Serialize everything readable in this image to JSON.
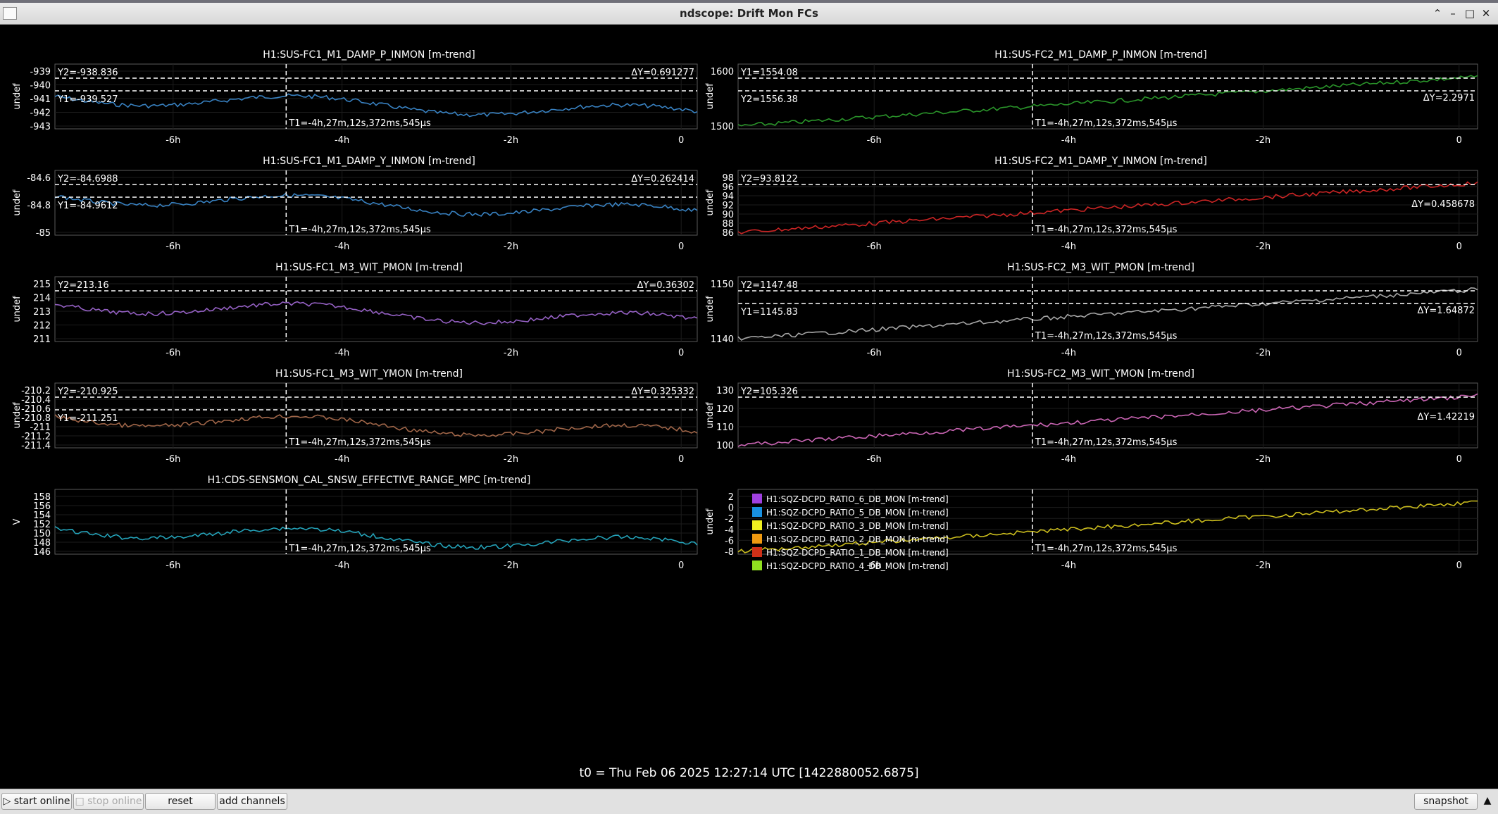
{
  "window": {
    "title": "ndscope: Drift Mon FCs",
    "buttons": {
      "keep_above": "⌃",
      "minimize": "–",
      "maximize": "□",
      "close": "✕"
    }
  },
  "plots": [
    {
      "title": "H1:SUS-FC1_M1_DAMP_P_INMON [m-trend]",
      "ylabel": "undef",
      "yticks": [
        "-939",
        "-940",
        "-941",
        "-942",
        "-943"
      ],
      "xticks": [
        "-6h",
        "-4h",
        "-2h",
        "0"
      ],
      "cursor_labels": [
        "Y2=-938.836",
        "Y1=-939.527"
      ],
      "delta": "ΔY=0.691277",
      "t1": "T1=-4h,27m,12s,372ms,545µs",
      "color": "#3e8fd6"
    },
    {
      "title": "H1:SUS-FC2_M1_DAMP_P_INMON [m-trend]",
      "ylabel": "undef",
      "yticks": [
        "1600",
        "1500"
      ],
      "xticks": [
        "-6h",
        "-4h",
        "-2h",
        "0"
      ],
      "cursor_labels": [
        "Y1=1554.08",
        "Y2=1556.38"
      ],
      "delta": "ΔY=2.2971",
      "t1": "T1=-4h,27m,12s,372ms,545µs",
      "color": "#2fa52f"
    },
    {
      "title": "H1:SUS-FC1_M1_DAMP_Y_INMON [m-trend]",
      "ylabel": "undef",
      "yticks": [
        "-84.6",
        "-84.8",
        "-85"
      ],
      "xticks": [
        "-6h",
        "-4h",
        "-2h",
        "0"
      ],
      "cursor_labels": [
        "Y2=-84.6988",
        "Y1=-84.9612"
      ],
      "delta": "ΔY=0.262414",
      "t1": "T1=-4h,27m,12s,372ms,545µs",
      "color": "#3e8fd6"
    },
    {
      "title": "H1:SUS-FC2_M1_DAMP_Y_INMON [m-trend]",
      "ylabel": "undef",
      "yticks": [
        "98",
        "96",
        "94",
        "92",
        "90",
        "88",
        "86"
      ],
      "xticks": [
        "-6h",
        "-4h",
        "-2h",
        "0"
      ],
      "cursor_labels": [
        "Y2=93.8122"
      ],
      "delta": "ΔY=0.458678",
      "t1": "T1=-4h,27m,12s,372ms,545µs",
      "color": "#e02828"
    },
    {
      "title": "H1:SUS-FC1_M3_WIT_PMON [m-trend]",
      "ylabel": "undef",
      "yticks": [
        "215",
        "214",
        "213",
        "212",
        "211"
      ],
      "xticks": [
        "-6h",
        "-4h",
        "-2h",
        "0"
      ],
      "cursor_labels": [
        "Y2=213.16"
      ],
      "delta": "ΔY=0.36302",
      "t1": "",
      "color": "#a46ad8"
    },
    {
      "title": "H1:SUS-FC2_M3_WIT_PMON [m-trend]",
      "ylabel": "undef",
      "yticks": [
        "1150",
        "1140"
      ],
      "xticks": [
        "-6h",
        "-4h",
        "-2h",
        "0"
      ],
      "cursor_labels": [
        "Y2=1147.48",
        "Y1=1145.83"
      ],
      "delta": "ΔY=1.64872",
      "t1": "T1=-4h,27m,12s,372ms,545µs",
      "color": "#b8b8b8"
    },
    {
      "title": "H1:SUS-FC1_M3_WIT_YMON [m-trend]",
      "ylabel": "undef",
      "yticks": [
        "-210.2",
        "-210.4",
        "-210.6",
        "-210.8",
        "-211",
        "-211.2",
        "-211.4"
      ],
      "xticks": [
        "-6h",
        "-4h",
        "-2h",
        "0"
      ],
      "cursor_labels": [
        "Y2=-210.925",
        "Y1=-211.251"
      ],
      "delta": "ΔY=0.325332",
      "t1": "T1=-4h,27m,12s,372ms,545µs",
      "color": "#b07050"
    },
    {
      "title": "H1:SUS-FC2_M3_WIT_YMON [m-trend]",
      "ylabel": "undef",
      "yticks": [
        "130",
        "120",
        "110",
        "100"
      ],
      "xticks": [
        "-6h",
        "-4h",
        "-2h",
        "0"
      ],
      "cursor_labels": [
        "Y2=105.326"
      ],
      "delta": "ΔY=1.42219",
      "t1": "T1=-4h,27m,12s,372ms,545µs",
      "color": "#e070c8"
    },
    {
      "title": "H1:CDS-SENSMON_CAL_SNSW_EFFECTIVE_RANGE_MPC [m-trend]",
      "ylabel": "V",
      "yticks": [
        "158",
        "156",
        "154",
        "152",
        "150",
        "148",
        "146"
      ],
      "xticks": [
        "-6h",
        "-4h",
        "-2h",
        "0"
      ],
      "cursor_labels": [],
      "delta": "",
      "t1": "T1=-4h,27m,12s,372ms,545µs",
      "color": "#28b4cc"
    },
    {
      "title": "",
      "ylabel": "undef",
      "yticks": [
        "2",
        "0",
        "-2",
        "-4",
        "-6",
        "-8"
      ],
      "xticks": [
        "-6h",
        "-4h",
        "-2h",
        "0"
      ],
      "cursor_labels": [],
      "delta": "",
      "t1": "T1=-4h,27m,12s,372ms,545µs",
      "color": "#e0d020",
      "legend": [
        {
          "name": "H1:SQZ-DCPD_RATIO_6_DB_MON [m-trend]",
          "color": "#a040e0"
        },
        {
          "name": "H1:SQZ-DCPD_RATIO_5_DB_MON [m-trend]",
          "color": "#1890e0"
        },
        {
          "name": "H1:SQZ-DCPD_RATIO_3_DB_MON [m-trend]",
          "color": "#f0f020"
        },
        {
          "name": "H1:SQZ-DCPD_RATIO_2_DB_MON [m-trend]",
          "color": "#f09a10"
        },
        {
          "name": "H1:SQZ-DCPD_RATIO_1_DB_MON [m-trend]",
          "color": "#d03018"
        },
        {
          "name": "H1:SQZ-DCPD_RATIO_4_DB_MON [m-trend]",
          "color": "#90e020"
        }
      ]
    }
  ],
  "t0_label": "t0 = Thu Feb 06 2025 12:27:14 UTC [1422880052.6875]",
  "toolbar": {
    "start_online": "start online",
    "stop_online": "stop online",
    "reset": "reset",
    "add_channels": "add channels",
    "snapshot": "snapshot"
  }
}
